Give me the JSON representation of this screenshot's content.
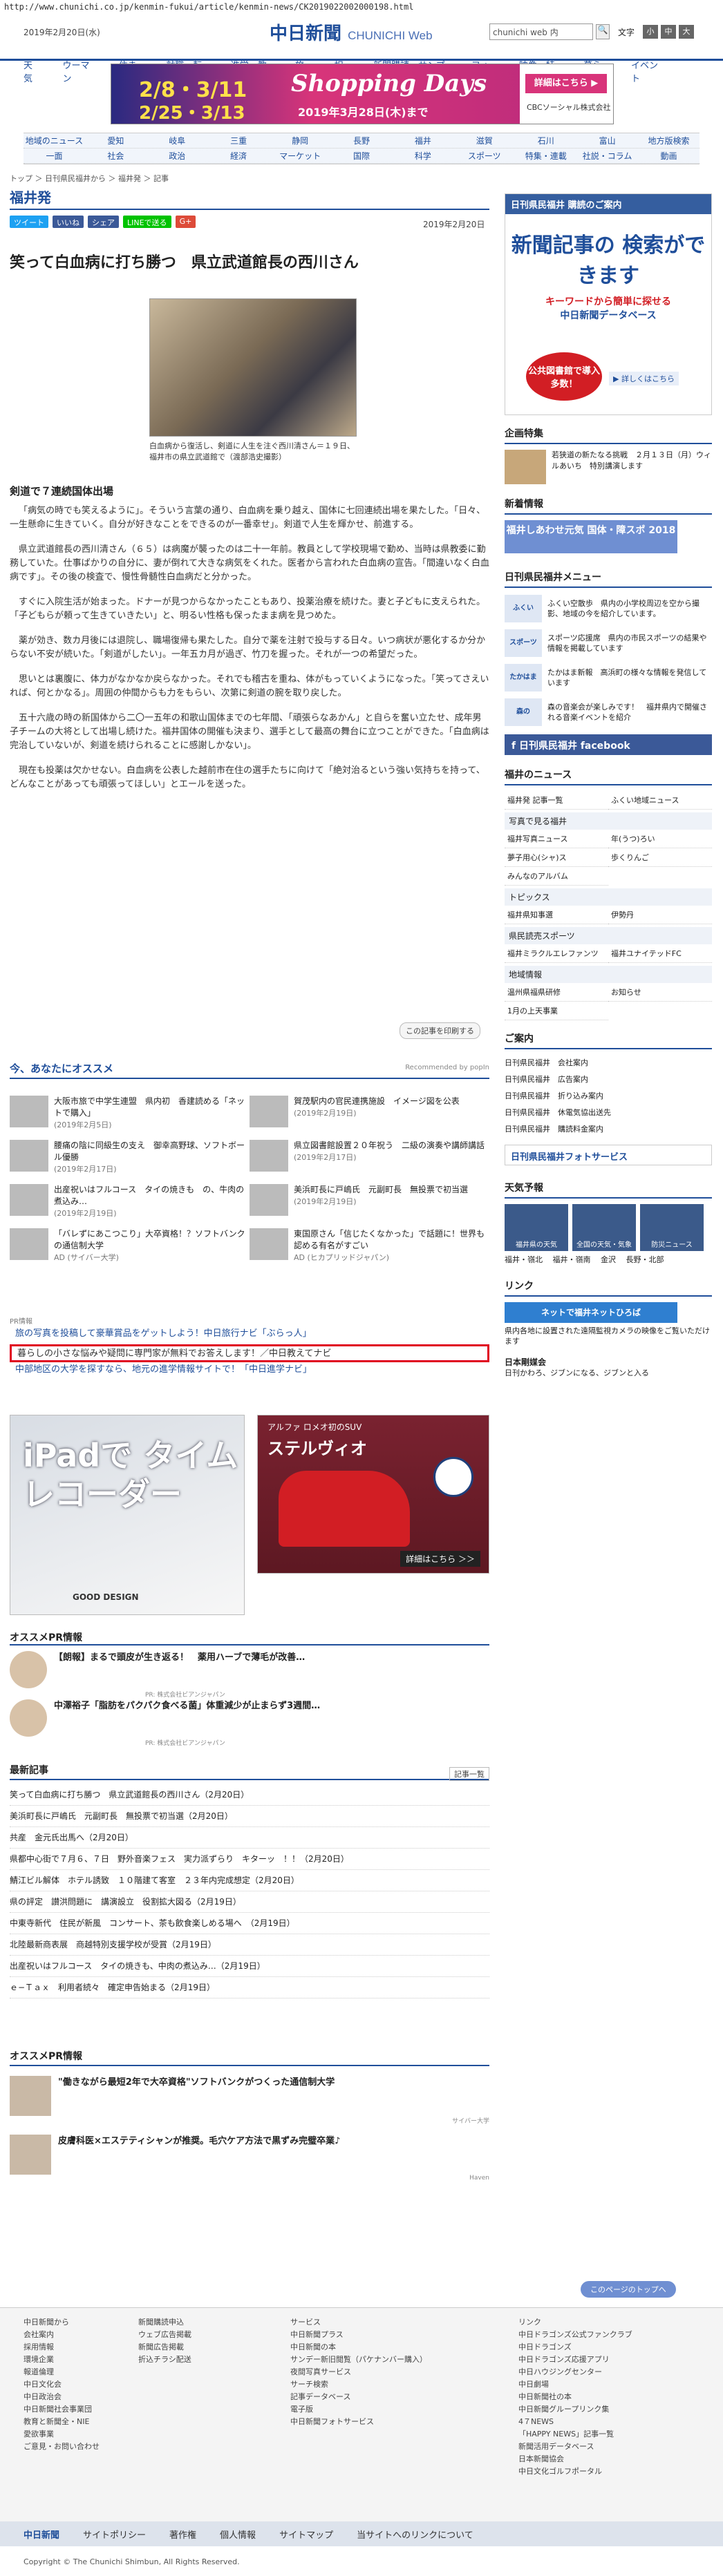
{
  "url": "http://www.chunichi.co.jp/kenmin-fukui/article/kenmin-news/CK2019022002000198.html",
  "header": {
    "date": "2019年2月20日(水)",
    "logo": "中日新聞",
    "logo_sub": "CHUNICHI Web",
    "search_placeholder": "chunichi web 内",
    "font_label": "文字",
    "font_small": "小",
    "font_mid": "中",
    "font_large": "大"
  },
  "gnav": [
    "天気",
    "ウーマン",
    "住まい",
    "就職・転職",
    "進学・教育",
    "旅行",
    "相談",
    "新聞購読・サンプル",
    "フォト",
    "映像・特集",
    "暮らし",
    "イベント"
  ],
  "banner": {
    "d1": "2/8・3/11",
    "d2": "2/25・3/13",
    "title": "Shopping Days",
    "date": "2019年3月28日(木)まで",
    "btn": "詳細はこちら ▶",
    "co": "CBCソーシャル株式会社"
  },
  "rnav": {
    "row1": [
      "地域のニュース",
      "愛知",
      "岐阜",
      "三重",
      "静岡",
      "長野",
      "福井",
      "滋賀",
      "石川",
      "富山",
      "地方版検索"
    ],
    "row2": [
      "一面",
      "社会",
      "政治",
      "経済",
      "マーケット",
      "国際",
      "科学",
      "スポーツ",
      "特集・連載",
      "社説・コラム",
      "動画"
    ]
  },
  "breadcrumb": "トップ ＞ 日刊県民福井から ＞ 福井発 ＞ 記事",
  "section_title": "福井発",
  "share": [
    "ツイート",
    "いいね",
    "シェア",
    "LINEで送る",
    "G+"
  ],
  "pub_date": "2019年2月20日",
  "headline": "笑って白血病に打ち勝つ　県立武道館長の西川さん",
  "caption": "白血病から復活し、剣道に人生を注ぐ西川清さん＝１９日、福井市の県立武道館で（渡部浩史撮影）",
  "subhead": "剣道で７連続国体出場",
  "paragraphs": [
    "「病気の時でも笑えるように」。そういう言葉の通り、白血病を乗り越え、国体に七回連続出場を果たした。「日々、一生懸命に生きていく。自分が好きなことをできるのが一番幸せ」。剣道で人生を輝かせ、前進する。",
    "県立武道館長の西川清さん（６５）は病魔が襲ったのは二十一年前。教員として学校現場で勤め、当時は県教委に勤務していた。仕事ばかりの自分に、妻が倒れて大きな病気をくれた。医者から言われた白血病の宣告。「間違いなく白血病です」。その後の検査で、慢性骨髄性白血病だと分かった。",
    "すぐに入院生活が始まった。ドナーが見つからなかったこともあり、投薬治療を続けた。妻と子どもに支えられた。「子どもらが頼って生きていきたい」と、明るい性格も保ったまま病を見つめた。",
    "薬が効き、数カ月後には退院し、職場復帰も果たした。自分で薬を注射で投与する日々。いつ病状が悪化するか分からない不安が続いた。「剣道がしたい」。一年五カ月が過ぎ、竹刀を握った。それが一つの希望だった。",
    "思いとは裏腹に、体力がなかなか戻らなかった。それでも稽古を重ね、体がもっていくようになった。「笑ってさえいれば、何とかなる」。周囲の仲間からも力をもらい、次第に剣道の腕を取り戻した。",
    "五十六歳の時の新国体から二〇一五年の和歌山国体までの七年間、「頑張らなあかん」と自らを奮い立たせ、成年男子チームの大将として出場し続けた。福井国体の開催も決まり、選手として最高の舞台に立つことができた。「白血病は完治していないが、剣道を続けられることに感謝しかない」。",
    "現在も投薬は欠かせない。白血病を公表した越前市在住の選手たちに向けて「絶対治るという強い気持ちを持って、どんなことがあっても頑張ってほしい」とエールを送った。"
  ],
  "clip_button": "この記事を印刷する",
  "rec": {
    "title": "今、あなたにオススメ",
    "provider": "Recommended by popIn",
    "items": [
      {
        "title": "大阪市旅で中学生連盟　県内初　香建読める「ネットで購入」",
        "date": "(2019年2月5日)"
      },
      {
        "title": "賀茂駅内の官民連携施設　イメージ図を公表",
        "date": "(2019年2月19日)"
      },
      {
        "title": "腰痛の陰に同級生の支え　御幸高野球、ソフトボール優勝",
        "date": "(2019年2月17日)"
      },
      {
        "title": "県立図書館設置２０年祝う　二級の演奏や講師講話",
        "date": "(2019年2月17日)"
      },
      {
        "title": "出産祝いはフルコース　タイの焼きも　の、牛肉の煮込み…",
        "date": "(2019年2月19日)"
      },
      {
        "title": "美浜町長に戸嶋氏　元副町長　無投票で初当選",
        "date": "(2019年2月19日)"
      },
      {
        "title": "「バレずにあこつこり」大卒資格！？ソフトバンクの通信制大学",
        "date": "AD (サイバー大学)"
      },
      {
        "title": "東国原さん「信じたくなかった」で話題に！世界も認める有名がすごい",
        "date": "AD (ヒカプリッドジャパン)"
      }
    ]
  },
  "pr_label": "PR情報",
  "pr_links": [
    "旅の写真を投稿して豪華賞品をゲットしよう！中日旅行ナビ「ぶらっ人」",
    "暮らしの小さな悩みや疑問に専門家が無料でお答えします！／中日教えてナビ",
    "中部地区の大学を探すなら、地元の進学情報サイトで！「中日進学ナビ」"
  ],
  "ad1": {
    "big": "iPadで タイム レコーダー",
    "gd": "GOOD DESIGN"
  },
  "ad2": {
    "sub": "アルファ ロメオ初のSUV",
    "name": "ステルヴィオ",
    "cta": "詳細はこちら ＞＞"
  },
  "osusume": {
    "title": "オススメPR情報",
    "item1": "【朗報】まるで頭皮が生き返る！　薬用ハーブで薄毛が改善…",
    "item1_ad": "PR: 株式会社ビアンジャパン",
    "item2": "中澤裕子「脂肪をパクパク食べる菌」体重減少が止まらず3週間…",
    "item2_ad": "PR: 株式会社ビアンジャパン"
  },
  "news": {
    "title": "最新記事",
    "more": "記事一覧",
    "items": [
      "笑って白血病に打ち勝つ　県立武道館長の西川さん（2月20日）",
      "美浜町長に戸嶋氏　元副町長　無投票で初当選（2月20日）",
      "共産　金元氏出馬へ（2月20日）",
      "県都中心街で７月６、７日　野外音楽フェス　実力派ずらり　キターッ　！！（2月20日）",
      "鯖江ビル解体　ホテル誘致　１０階建て客室　２３年内完成想定（2月20日）",
      "県の評定　讃洪問題に　講演設立　役割拡大図る（2月19日）",
      "中東寺新代　住民が新風　コンサート、茶も飲食楽しめる場へ　（2月19日）",
      "北陸最新商表展　商越特別支援学校が受賞（2月19日）",
      "出産祝いはフルコース　タイの焼きも、中肉の煮込み…（2月19日）",
      "ｅ−Ｔａｘ　利用者続々　確定申告始まる（2月19日）"
    ]
  },
  "pr2": {
    "title": "オススメPR情報",
    "item1": "\"働きながら最短2年で大卒資格\"ソフトバンクがつくった通信制大学",
    "item1_ad": "サイバー大学",
    "item2": "皮膚科医×エステティシャンが推奨。毛穴ケア方法で黒ずみ完璧卒業♪",
    "item2_ad": "Haven"
  },
  "sidebar": {
    "kenmin_head": "日刊県民福井 購読のご案内",
    "db_a": "新聞記事の 検索ができます",
    "db_b": "キーワードから簡単に探せる",
    "db_c": "中日新聞データベース",
    "db_d": "公共図書館で導入多数！",
    "db_e": "▶ 詳しくはこちら",
    "kikaku_title": "企画特集",
    "kikaku_text": "若狭道の新たなる挑戦　２月１３日（月）ウィルあいち　特別講演します",
    "shin_title": "新着情報",
    "shin_banner": "福井しあわせ元気 国体・障スポ 2018",
    "menu_title": "日刊県民福井メニュー",
    "menu": [
      {
        "ic": "ふくい",
        "tx": "ふくい空散歩　県内の小学校周辺を空から撮影、地域の今を紹介しています。"
      },
      {
        "ic": "スポーツ",
        "tx": "スポーツ応援席　県内の市民スポーツの結果や情報を掲載しています"
      },
      {
        "ic": "たかはま",
        "tx": "たかはま新報　高浜町の様々な情報を発信しています"
      },
      {
        "ic": "森の",
        "tx": "森の音楽会が楽しみです！　福井県内で開催される音楽イベントを紹介"
      }
    ],
    "fb": "日刊県民福井 facebook",
    "news_title": "福井のニュース",
    "news_links": [
      "福井発 記事一覧",
      "ふくい地域ニュース"
    ],
    "photo_bar": "写真で見る福井",
    "photo_links": [
      "福井写真ニュース",
      "年(うつ)ろい",
      "夢子用心(シャ)ス",
      "歩くりんご",
      "みんなのアルバム"
    ],
    "topics": "トピックス",
    "topic_links": [
      "福井県知事選",
      "伊勢丹"
    ],
    "sports_bar": "県民読売スポーツ",
    "sports_links": [
      "福井ミラクルエレファンツ",
      "福井ユナイテッドFC"
    ],
    "local_bar": "地域情報",
    "local_links": [
      "温州県福県研修",
      "お知らせ",
      "1月の上天事業"
    ],
    "guide_title": "ご案内",
    "guide_links": [
      "日刊県民福井　会社案内",
      "日刊県民福井　広告案内",
      "日刊県民福井　折り込み案内",
      "日刊県民福井　休電気協出送先",
      "日刊県民福井　購読料金案内"
    ],
    "photo_service": "日刊県民福井フォトサービス",
    "weather_title": "天気予報",
    "weather": [
      "福井県の天気",
      "全国の天気・気象",
      "防災ニュース"
    ],
    "weather_links": [
      "福井・嶺北",
      "福井・嶺南",
      "金沢",
      "長野・北部"
    ],
    "link_title": "リンク",
    "link_banner": "ネットで福井ネットひろば",
    "link_text": "県内各地に設置された遠隔監視カメラの映像をご覧いただけます",
    "nihon": "日本剛媒会",
    "nihon_text": "日刊かわろ、ジブンになる、ジブンと入る"
  },
  "footer": {
    "top": "このページのトップへ",
    "col1": [
      "中日新聞から",
      "会社案内",
      "採用情報",
      "環境企業",
      "報道倫理",
      "中日文化会",
      "中日政治会",
      "中日新聞社会事業団",
      "教育と新聞全・NIE",
      "愛欲事業",
      "ご意見・お問い合わせ"
    ],
    "col2": [
      "",
      "新聞購読申込",
      "ウェブ広告掲載",
      "新聞広告掲載",
      "折込チラシ配送"
    ],
    "col3": [
      "サービス",
      "中日新聞プラス",
      "中日新聞の本",
      "サンデー新旧閲覧（パケナンバー購入）",
      "夜間写真サービス",
      "サーチ検索",
      "記事データベース",
      "電子版",
      "中日新聞フォトサービス"
    ],
    "col4": [
      "リンク",
      "中日ドラゴンズ公式ファンクラブ",
      "中日ドラゴンズ",
      "中日ドラゴンズ応援アプリ",
      "中日ハウジングセンター",
      "中日劇場",
      "中日新聞社の本",
      "中日新聞グループリンク集",
      "4７NEWS",
      "「HAPPY NEWS」記事一覧",
      "新聞活用データベース",
      "日本新聞協会",
      "中日文化ゴルフポータル"
    ],
    "bar": [
      "中日新聞",
      "サイトポリシー",
      "著作権",
      "個人情報",
      "サイトマップ",
      "当サイトへのリンクについて"
    ],
    "copy": "Copyright © The Chunichi Shimbun, All Rights Reserved."
  }
}
